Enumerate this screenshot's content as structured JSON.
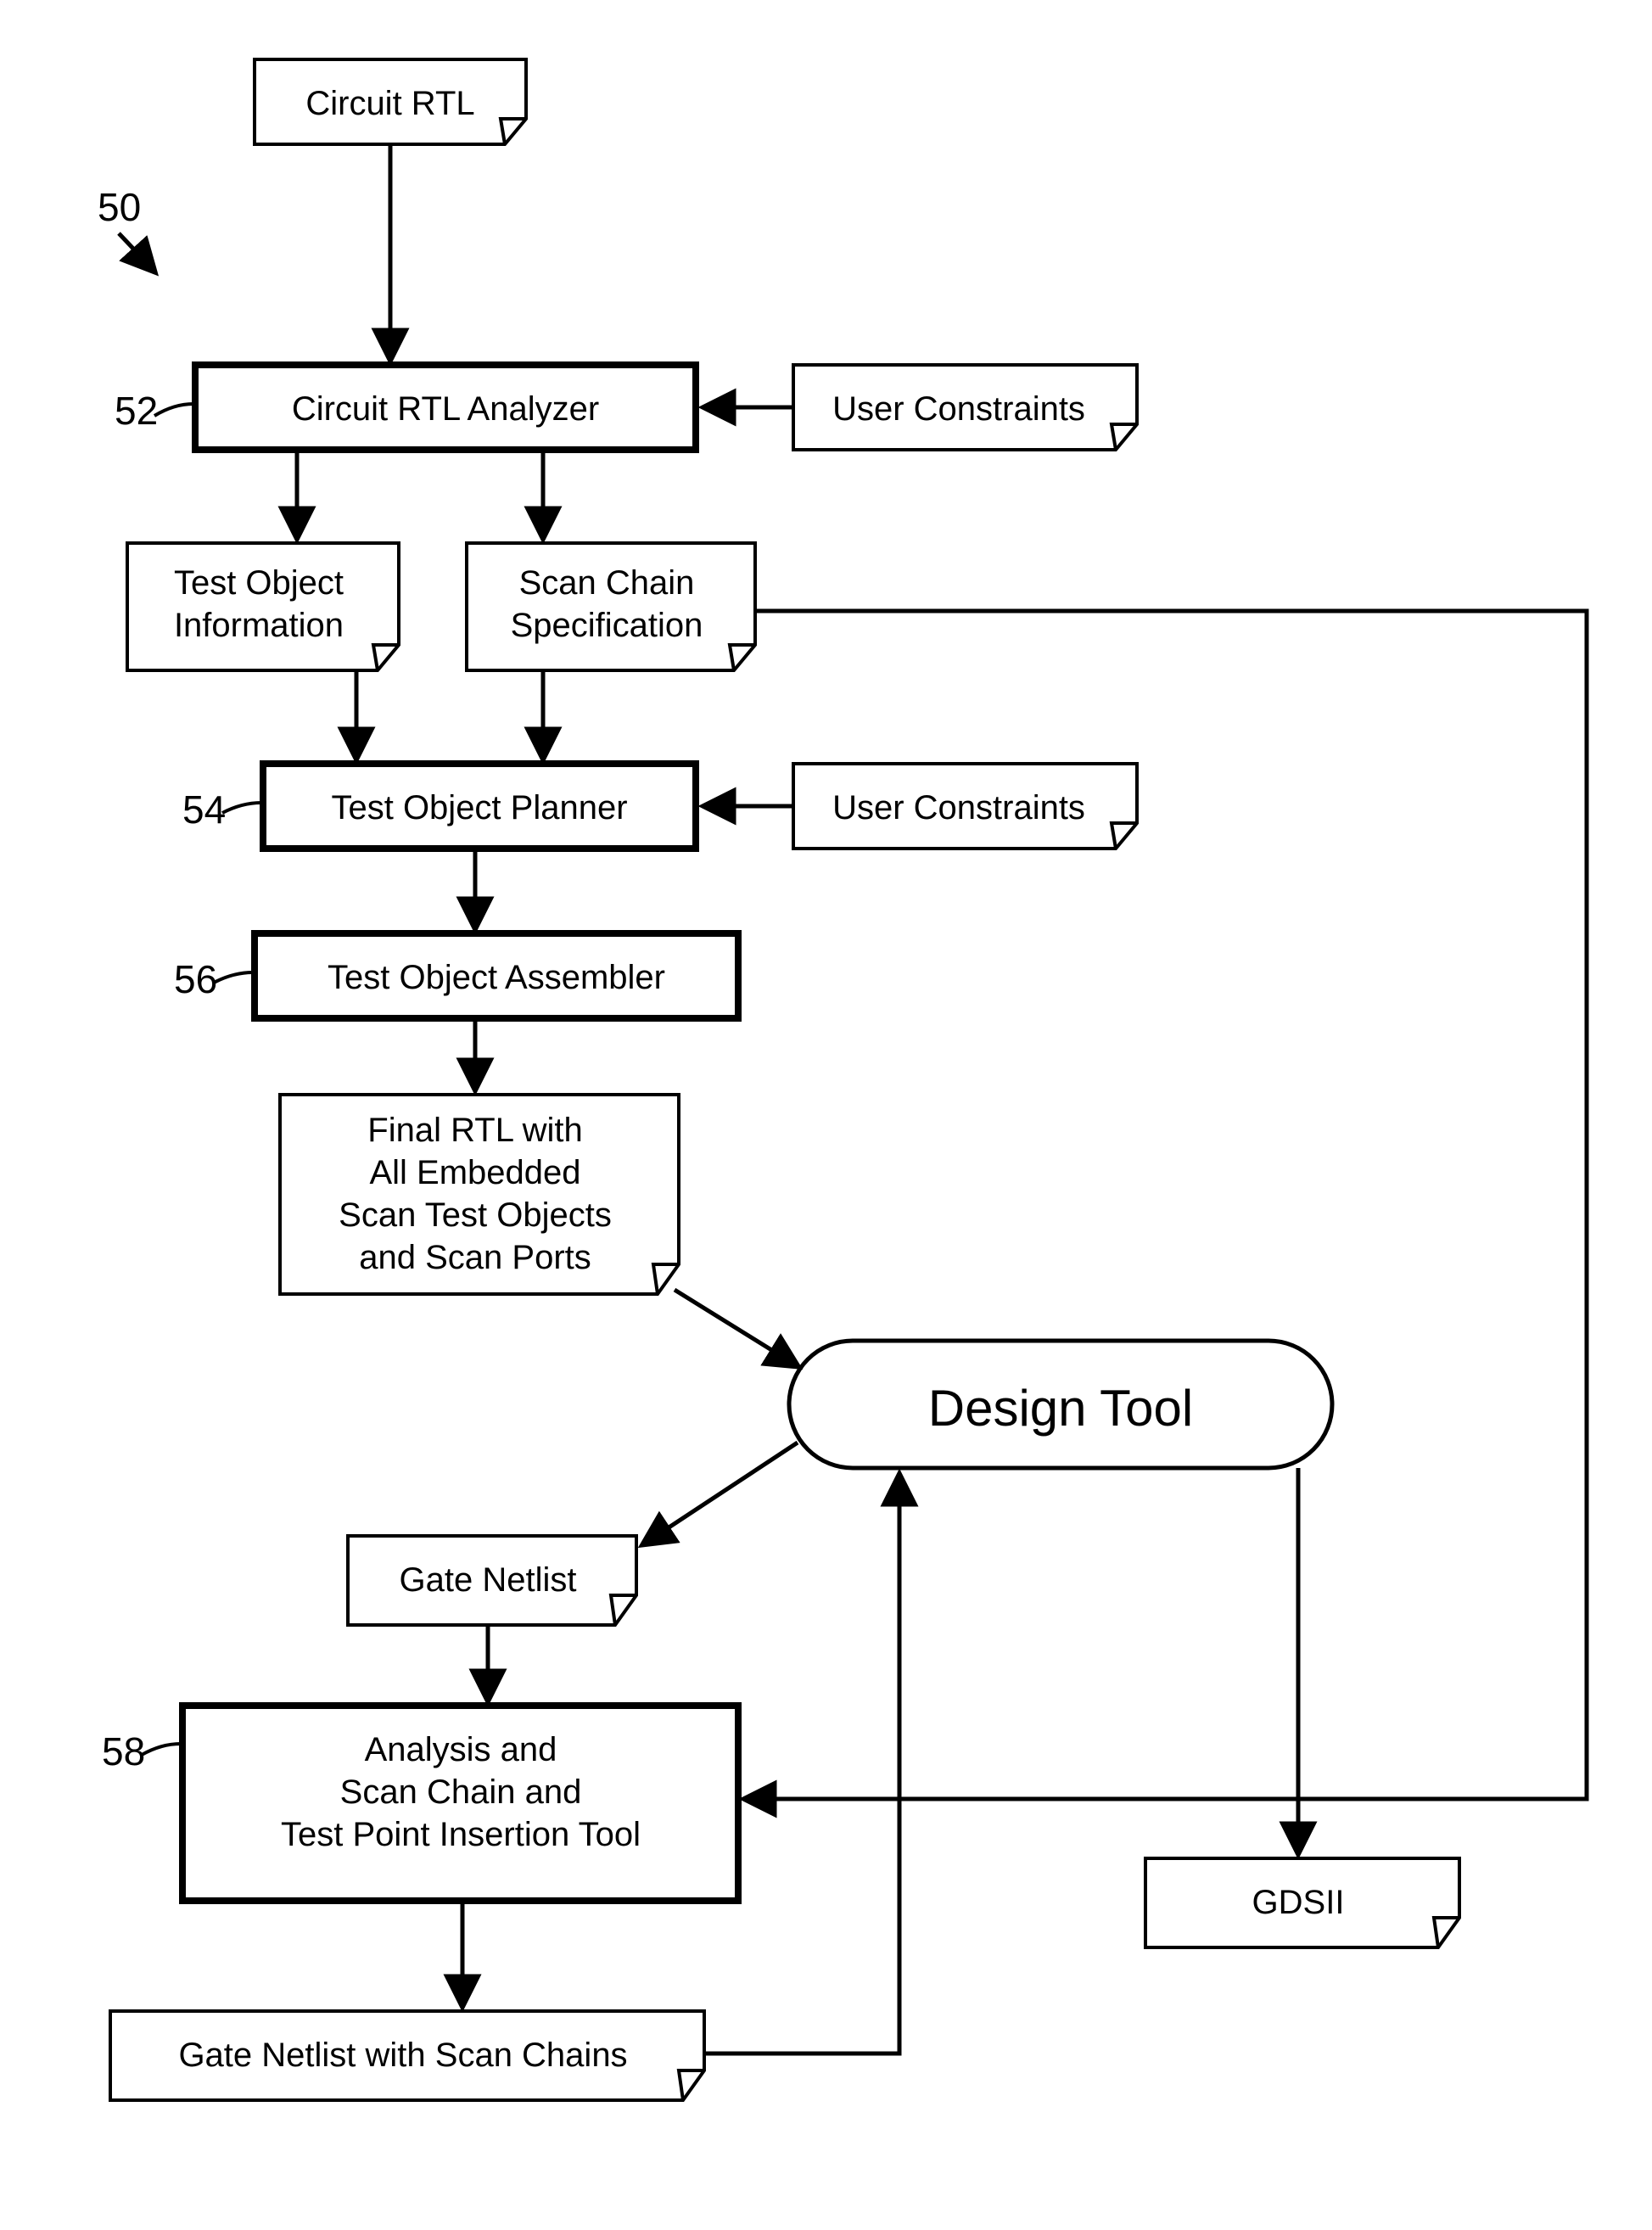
{
  "refs": {
    "fig": "50",
    "analyzer": "52",
    "planner": "54",
    "assembler": "56",
    "insertion": "58"
  },
  "nodes": {
    "circuitRtl": "Circuit RTL",
    "analyzer": "Circuit RTL Analyzer",
    "userConstraints1": "User Constraints",
    "testObjInfoL1": "Test Object",
    "testObjInfoL2": "Information",
    "scanChainSpecL1": "Scan Chain",
    "scanChainSpecL2": "Specification",
    "planner": "Test Object Planner",
    "userConstraints2": "User Constraints",
    "assembler": "Test Object Assembler",
    "finalRtlL1": "Final RTL with",
    "finalRtlL2": "All Embedded",
    "finalRtlL3": "Scan Test Objects",
    "finalRtlL4": "and Scan Ports",
    "designTool": "Design Tool",
    "gateNetlist": "Gate Netlist",
    "insertionL1": "Analysis and",
    "insertionL2": "Scan Chain and",
    "insertionL3": "Test Point Insertion Tool",
    "gdsii": "GDSII",
    "gateNetlistScan": "Gate Netlist with Scan Chains"
  }
}
